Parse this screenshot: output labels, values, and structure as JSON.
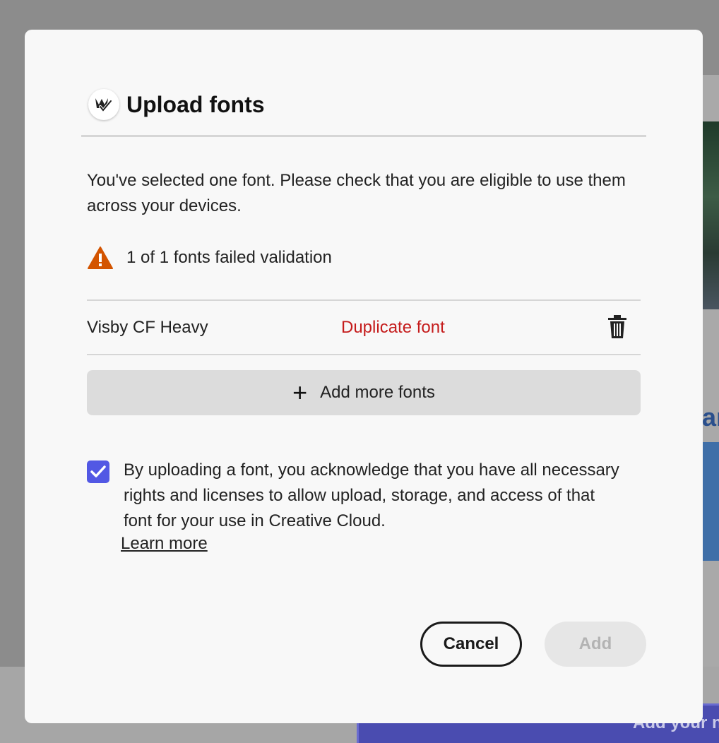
{
  "background": {
    "blue_text_fragment": "ar",
    "button_text_fragment": "Add your n"
  },
  "dialog": {
    "title": "Upload fonts",
    "logo_icon": "adobe-fonts-logo-icon",
    "intro": "You've selected one font. Please check that you are eligible to use them across your devices.",
    "warning": {
      "icon": "warning-triangle-icon",
      "color": "#D35400",
      "message": "1 of 1 fonts failed validation"
    },
    "fonts": [
      {
        "name": "Visby CF Heavy",
        "status": "Duplicate font",
        "status_color": "#C51C1C"
      }
    ],
    "add_more_label": "Add more fonts",
    "acknowledgement": {
      "checked": true,
      "checkbox_color": "#5258E4",
      "text": "By uploading a font, you acknowledge that you have all necessary rights and licenses to allow upload, storage, and access of that font for your use in Creative Cloud.",
      "learn_more_label": "Learn more"
    },
    "cancel_label": "Cancel",
    "add_label": "Add"
  }
}
